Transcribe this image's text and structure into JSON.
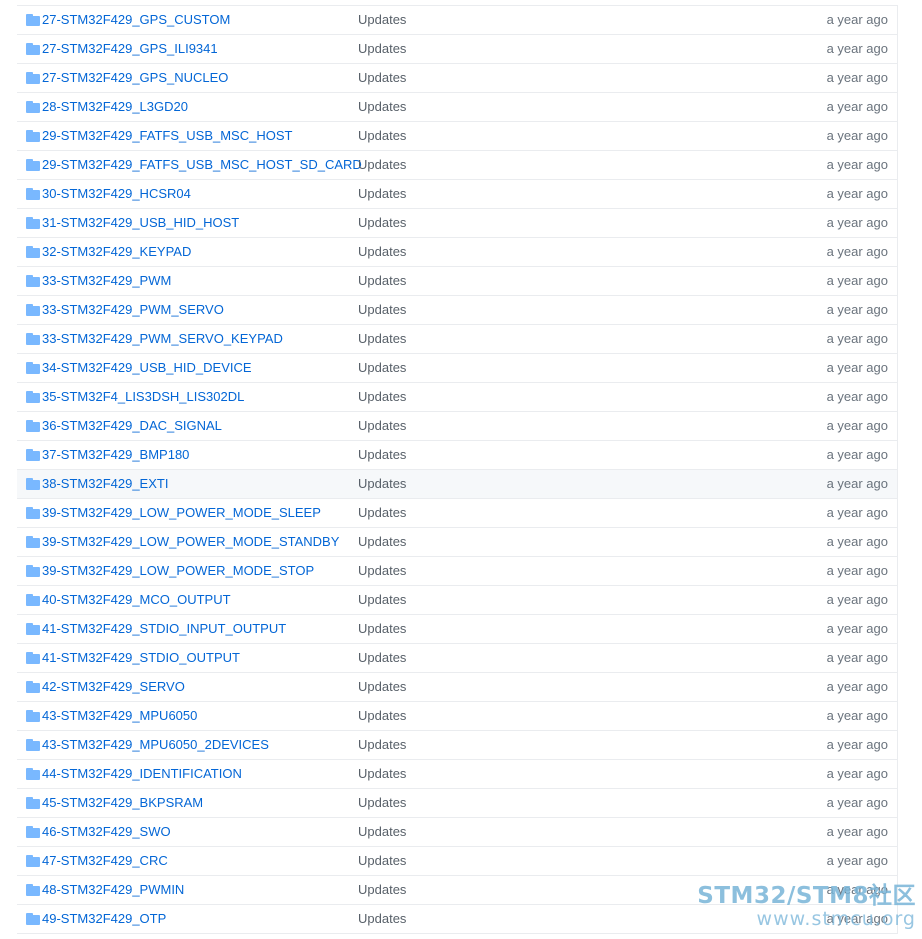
{
  "file_list": {
    "rows": [
      {
        "name": "27-STM32F429_GPS_CUSTOM",
        "message": "Updates",
        "age": "a year ago"
      },
      {
        "name": "27-STM32F429_GPS_ILI9341",
        "message": "Updates",
        "age": "a year ago"
      },
      {
        "name": "27-STM32F429_GPS_NUCLEO",
        "message": "Updates",
        "age": "a year ago"
      },
      {
        "name": "28-STM32F429_L3GD20",
        "message": "Updates",
        "age": "a year ago"
      },
      {
        "name": "29-STM32F429_FATFS_USB_MSC_HOST",
        "message": "Updates",
        "age": "a year ago"
      },
      {
        "name": "29-STM32F429_FATFS_USB_MSC_HOST_SD_CARD",
        "message": "Updates",
        "age": "a year ago"
      },
      {
        "name": "30-STM32F429_HCSR04",
        "message": "Updates",
        "age": "a year ago"
      },
      {
        "name": "31-STM32F429_USB_HID_HOST",
        "message": "Updates",
        "age": "a year ago"
      },
      {
        "name": "32-STM32F429_KEYPAD",
        "message": "Updates",
        "age": "a year ago"
      },
      {
        "name": "33-STM32F429_PWM",
        "message": "Updates",
        "age": "a year ago"
      },
      {
        "name": "33-STM32F429_PWM_SERVO",
        "message": "Updates",
        "age": "a year ago"
      },
      {
        "name": "33-STM32F429_PWM_SERVO_KEYPAD",
        "message": "Updates",
        "age": "a year ago"
      },
      {
        "name": "34-STM32F429_USB_HID_DEVICE",
        "message": "Updates",
        "age": "a year ago"
      },
      {
        "name": "35-STM32F4_LIS3DSH_LIS302DL",
        "message": "Updates",
        "age": "a year ago"
      },
      {
        "name": "36-STM32F429_DAC_SIGNAL",
        "message": "Updates",
        "age": "a year ago"
      },
      {
        "name": "37-STM32F429_BMP180",
        "message": "Updates",
        "age": "a year ago"
      },
      {
        "name": "38-STM32F429_EXTI",
        "message": "Updates",
        "age": "a year ago",
        "highlighted": true
      },
      {
        "name": "39-STM32F429_LOW_POWER_MODE_SLEEP",
        "message": "Updates",
        "age": "a year ago"
      },
      {
        "name": "39-STM32F429_LOW_POWER_MODE_STANDBY",
        "message": "Updates",
        "age": "a year ago"
      },
      {
        "name": "39-STM32F429_LOW_POWER_MODE_STOP",
        "message": "Updates",
        "age": "a year ago"
      },
      {
        "name": "40-STM32F429_MCO_OUTPUT",
        "message": "Updates",
        "age": "a year ago"
      },
      {
        "name": "41-STM32F429_STDIO_INPUT_OUTPUT",
        "message": "Updates",
        "age": "a year ago"
      },
      {
        "name": "41-STM32F429_STDIO_OUTPUT",
        "message": "Updates",
        "age": "a year ago"
      },
      {
        "name": "42-STM32F429_SERVO",
        "message": "Updates",
        "age": "a year ago"
      },
      {
        "name": "43-STM32F429_MPU6050",
        "message": "Updates",
        "age": "a year ago"
      },
      {
        "name": "43-STM32F429_MPU6050_2DEVICES",
        "message": "Updates",
        "age": "a year ago"
      },
      {
        "name": "44-STM32F429_IDENTIFICATION",
        "message": "Updates",
        "age": "a year ago"
      },
      {
        "name": "45-STM32F429_BKPSRAM",
        "message": "Updates",
        "age": "a year ago"
      },
      {
        "name": "46-STM32F429_SWO",
        "message": "Updates",
        "age": "a year ago"
      },
      {
        "name": "47-STM32F429_CRC",
        "message": "Updates",
        "age": "a year ago"
      },
      {
        "name": "48-STM32F429_PWMIN",
        "message": "Updates",
        "age": "a year ago"
      },
      {
        "name": "49-STM32F429_OTP",
        "message": "Updates",
        "age": "a year ago"
      }
    ]
  },
  "watermark": {
    "line1": "STM32/STM8社区",
    "line2": "www.stmcu.org"
  },
  "colors": {
    "link": "#0366d6",
    "folder_icon": "#79b8ff",
    "row_border": "#eaecef",
    "row_highlight": "#f6f8fa",
    "muted_text": "#6a737d"
  },
  "icons": {
    "row_icon": "folder-icon"
  }
}
